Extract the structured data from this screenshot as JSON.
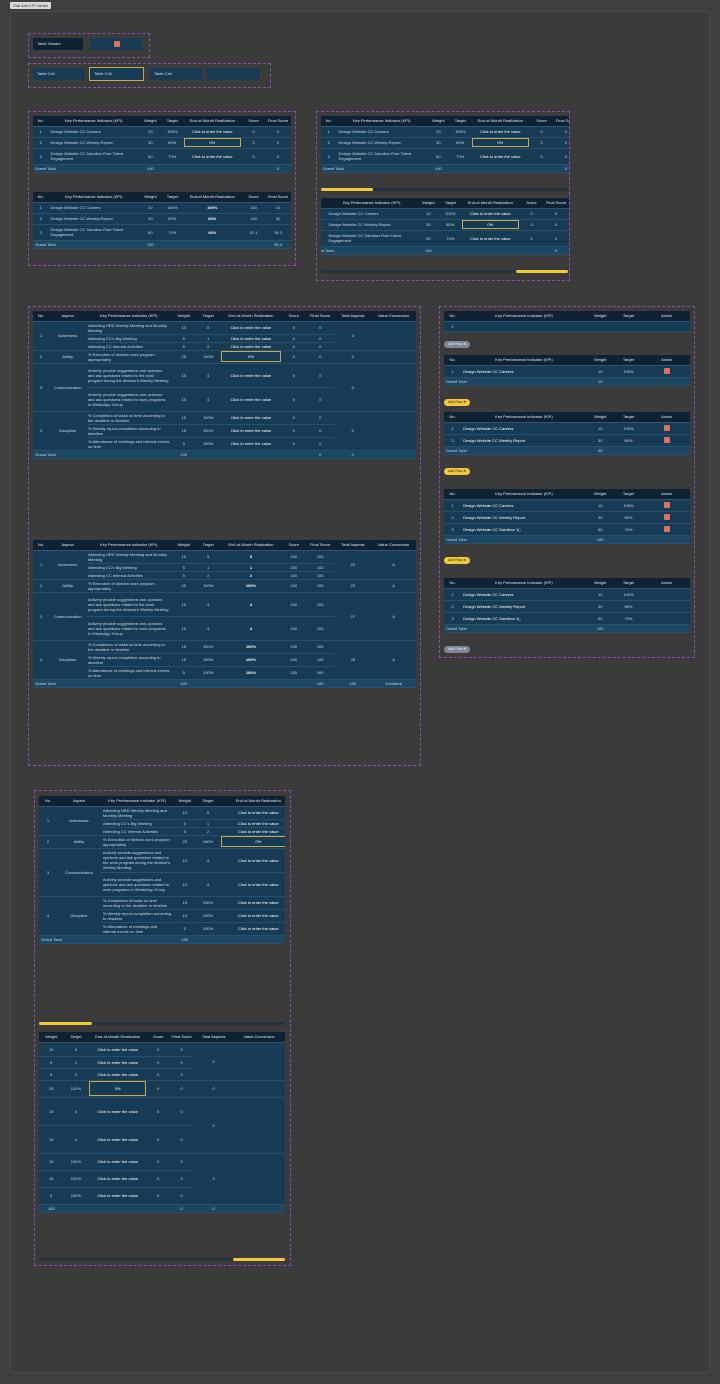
{
  "tag": "Stat Add KPI Varian",
  "components": {
    "table_header": "Table Header",
    "table_cell": "Table Cell"
  },
  "cols_simple": [
    "No.",
    "Key Performance Indicator (KPI)",
    "Weight",
    "Target",
    "End-of-Month Realization",
    "Score",
    "Final Score"
  ],
  "cols_simple_noscore": [
    "No.",
    "Key Performance Indicator (KPI)",
    "Weight",
    "Target",
    "End-of-Month Realization",
    "Score",
    "Final Score"
  ],
  "cols_aspect": [
    "No.",
    "Aspect",
    "Key Performance Indicator (KPI)",
    "Weight",
    "Target",
    "End-of-Month Realization",
    "Score",
    "Final Score",
    "Total Aspects",
    "Value Conversion"
  ],
  "cols_action": [
    "No.",
    "Key Performance Indicator (KPI)",
    "Weight",
    "Target",
    "Action"
  ],
  "cols_aspect_short": [
    "No.",
    "Aspect",
    "Key Performance Indicator (KPI)",
    "Weight",
    "Target",
    "End-of-Month Realization"
  ],
  "cols_scroll_right": [
    "Weight",
    "Target",
    "End-of-Month Realization",
    "Score",
    "Final Score",
    "Total Aspects",
    "Value Conversion"
  ],
  "placeholder": "Click to enter the value",
  "zero_pct": "0%",
  "grand_total": "Grand Total",
  "add_row": "Add Row",
  "simple_kpis": [
    "Design Website CC Careers",
    "Design Website CC Weekly Report",
    "Design Website CC Sandbox Role Talent Engagement"
  ],
  "simple_weights": [
    "10",
    "30",
    "60",
    "100"
  ],
  "simple_targets": [
    "100%",
    "80%",
    "70%"
  ],
  "simple_filled": {
    "real": [
      "100%",
      "80%",
      "40%"
    ],
    "score": [
      "100",
      "100",
      "57.1"
    ],
    "final": [
      "10",
      "30",
      "34.3"
    ],
    "total": "95.4"
  },
  "aspects": [
    "Activeness",
    "Ability",
    "Communication",
    "Discipline"
  ],
  "aspect_kpis": [
    "Attending HRD Weekly Meeting and Monthly Meeting",
    "Attending CC's Big Meeting",
    "Attending CC Internal Activities",
    "% Execution of division work program appropriately",
    "Actively provide suggestions and opinions and ask questions related to the work program during the division's Weekly Meeting",
    "Actively provide suggestions and opinions and ask questions related to work programs in WhatsApp Group",
    "% Completion of tasks on time according to the deadline or timeline",
    "% Weekly report completion according to deadline",
    "% Attendance of meetings and internal events on time"
  ],
  "aspect_weights": [
    "10",
    "5",
    "5",
    "25",
    "10",
    "10",
    "15",
    "15",
    "5",
    "100"
  ],
  "aspect_targets": [
    "5",
    "1",
    "2",
    "100%",
    "4",
    "4",
    "100%",
    "100%",
    "100%"
  ],
  "aspect_filled": {
    "real": [
      "5",
      "1",
      "2",
      "100%",
      "4",
      "4",
      "100%",
      "100%",
      "100%"
    ],
    "totals": [
      "20",
      "25",
      "22",
      "35"
    ],
    "conv": [
      "A",
      "A",
      "A",
      "A"
    ],
    "grand_score": "100",
    "grand_total_aspects": "100",
    "grand_conv": "Excellent"
  },
  "action_kpis": [
    "Design Website CC Careers",
    "Design Website CC Weekly Report",
    "Design Website CC Sandbox 1(;"
  ],
  "action_weights": [
    "10",
    "30",
    "60",
    "100"
  ],
  "action_targets": [
    "100%",
    "80%",
    "70%"
  ],
  "row_one": "1"
}
